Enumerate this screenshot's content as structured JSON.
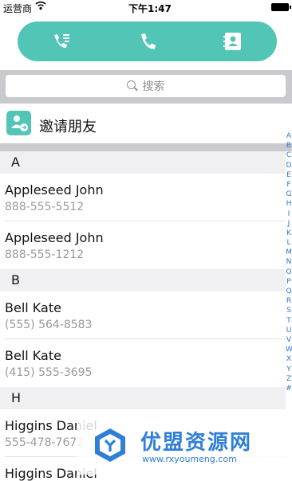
{
  "status_bar": {
    "carrier": "运营商",
    "wifi_icon": "wifi-icon",
    "time": "下午1:47",
    "battery_icon": "battery-icon"
  },
  "tabs": [
    {
      "icon": "call-log-icon"
    },
    {
      "icon": "phone-icon"
    },
    {
      "icon": "contacts-book-icon"
    }
  ],
  "colors": {
    "accent": "#52c5b6",
    "search_bg": "#c9c9ce",
    "index": "#2f74d0",
    "watermark": "#2f7fd8"
  },
  "search": {
    "placeholder": "搜索"
  },
  "invite": {
    "label": "邀请朋友",
    "icon": "invite-friend-icon"
  },
  "sections": [
    {
      "letter": "A",
      "contacts": [
        {
          "name": "Appleseed John",
          "phone": "888-555-5512"
        },
        {
          "name": "Appleseed John",
          "phone": "888-555-1212"
        }
      ]
    },
    {
      "letter": "B",
      "contacts": [
        {
          "name": "Bell Kate",
          "phone": "(555) 564-8583"
        },
        {
          "name": "Bell Kate",
          "phone": "(415) 555-3695"
        }
      ]
    },
    {
      "letter": "H",
      "contacts": [
        {
          "name": "Higgins Daniel",
          "phone": "555-478-7672"
        },
        {
          "name": "Higgins Daniel",
          "phone": ""
        }
      ]
    }
  ],
  "index_letters": [
    "A",
    "B",
    "C",
    "D",
    "E",
    "F",
    "G",
    "H",
    "I",
    "J",
    "K",
    "L",
    "M",
    "N",
    "O",
    "P",
    "Q",
    "R",
    "S",
    "T",
    "U",
    "V",
    "W",
    "X",
    "Y",
    "Z",
    "#"
  ],
  "watermark": {
    "title": "优盟资源网",
    "url": "www.rxyoumeng.com"
  }
}
